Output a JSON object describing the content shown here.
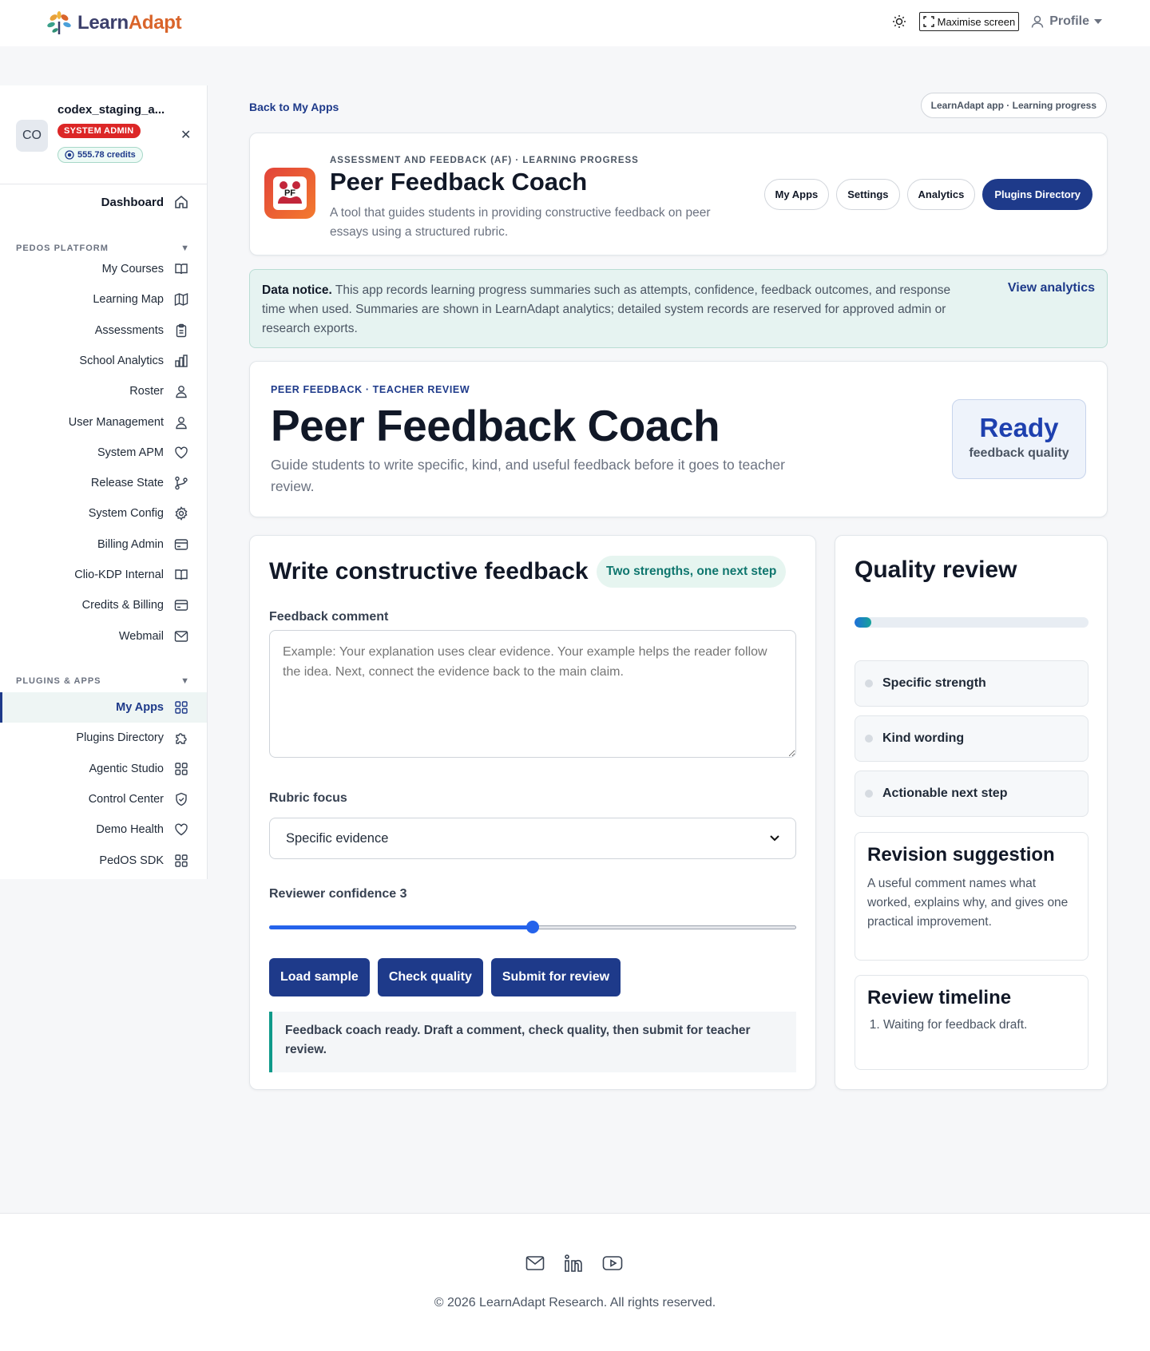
{
  "brand": {
    "name_part1": "Learn",
    "name_part2": "Adapt"
  },
  "header": {
    "maximise_label": "Maximise screen",
    "profile_label": "Profile"
  },
  "user": {
    "avatar_initials": "CO",
    "name": "codex_staging_a...",
    "role": "SYSTEM ADMIN",
    "credits": "555.78 credits"
  },
  "sidebar": {
    "dashboard": "Dashboard",
    "section1": "PEDOS PLATFORM",
    "platform_items": [
      "My Courses",
      "Learning Map",
      "Assessments",
      "School Analytics",
      "Roster",
      "User Management",
      "System APM",
      "Release State",
      "System Config",
      "Billing Admin",
      "Clio-KDP Internal",
      "Credits & Billing",
      "Webmail"
    ],
    "section2": "PLUGINS & APPS",
    "plugin_items": [
      "My Apps",
      "Plugins Directory",
      "Agentic Studio",
      "Control Center",
      "Demo Health",
      "PedOS SDK"
    ]
  },
  "main": {
    "back_link": "Back to My Apps",
    "app_pill": "LearnAdapt app · Learning progress",
    "app_eyebrow": "ASSESSMENT AND FEEDBACK (AF) · LEARNING PROGRESS",
    "app_title": "Peer Feedback Coach",
    "app_desc": "A tool that guides students in providing constructive feedback on peer essays using a structured rubric.",
    "app_icon_text": "PF",
    "nav_buttons": [
      "My Apps",
      "Settings",
      "Analytics",
      "Plugins Directory"
    ]
  },
  "notice": {
    "lead": "Data notice.",
    "text": " This app records learning progress summaries such as attempts, confidence, feedback outcomes, and response time when used. Summaries are shown in LearnAdapt analytics; detailed system records are reserved for approved admin or research exports.",
    "link": "View analytics"
  },
  "hero": {
    "eyebrow": "PEER FEEDBACK · TEACHER REVIEW",
    "title": "Peer Feedback Coach",
    "subtitle": "Guide students to write specific, kind, and useful feedback before it goes to teacher review.",
    "status_value": "Ready",
    "status_label": "feedback quality"
  },
  "form": {
    "title": "Write constructive feedback",
    "chip": "Two strengths, one next step",
    "comment_label": "Feedback comment",
    "comment_placeholder": "Example: Your explanation uses clear evidence. Your example helps the reader follow the idea. Next, connect the evidence back to the main claim.",
    "comment_value": "",
    "rubric_label": "Rubric focus",
    "rubric_selected": "Specific evidence",
    "confidence_label": "Reviewer confidence 3",
    "confidence_value": 3,
    "confidence_min": 1,
    "confidence_max": 5,
    "buttons": [
      "Load sample",
      "Check quality",
      "Submit for review"
    ],
    "status": "Feedback coach ready. Draft a comment, check quality, then submit for teacher review."
  },
  "review": {
    "title": "Quality review",
    "progress_fraction": 0.07,
    "checks": [
      "Specific strength",
      "Kind wording",
      "Actionable next step"
    ],
    "suggestion_title": "Revision suggestion",
    "suggestion_text": "A useful comment names what worked, explains why, and gives one practical improvement.",
    "timeline_title": "Review timeline",
    "timeline": [
      "Waiting for feedback draft."
    ]
  },
  "footer": {
    "copyright": "© 2026 LearnAdapt Research. All rights reserved.",
    "icons": [
      "mail-icon",
      "linkedin-icon",
      "youtube-icon"
    ]
  },
  "colors": {
    "primary": "#1e3a8a",
    "accent_teal": "#0f766e",
    "danger": "#dc2626",
    "brand_orange": "#d9642a"
  }
}
